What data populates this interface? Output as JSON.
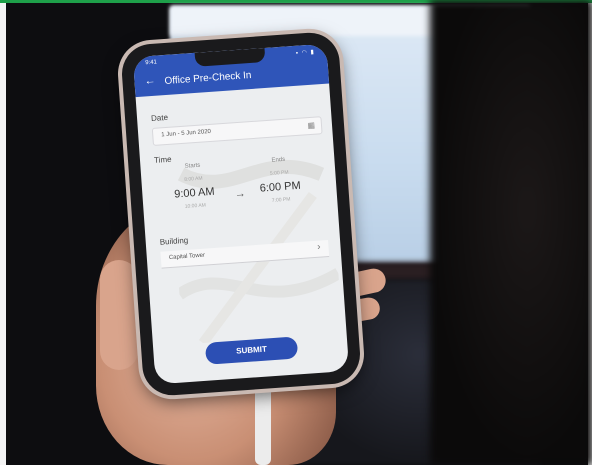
{
  "status": {
    "time": "9:41",
    "icons": "▪ ◠ ▮"
  },
  "app": {
    "title": "Office Pre-Check In",
    "date_label": "Date",
    "date_value": "1 Jun - 5 Jun 2020",
    "time_label": "Time",
    "starts_label": "Starts",
    "ends_label": "Ends",
    "start_above": "8:00 AM",
    "start_time": "9:00 AM",
    "start_below": "10:00 AM",
    "end_above": "5:00 PM",
    "end_time": "6:00 PM",
    "end_below": "7:00 PM",
    "building_label": "Building",
    "building_value": "Capital Tower",
    "submit_label": "SUBMIT"
  },
  "colors": {
    "app_bar": "#2f55b9",
    "submit": "#2c4fb4",
    "top_strip": "#1ea04a"
  },
  "icons": [
    "back-arrow-icon",
    "calendar-icon",
    "arrow-right-icon",
    "chevron-right-icon"
  ]
}
